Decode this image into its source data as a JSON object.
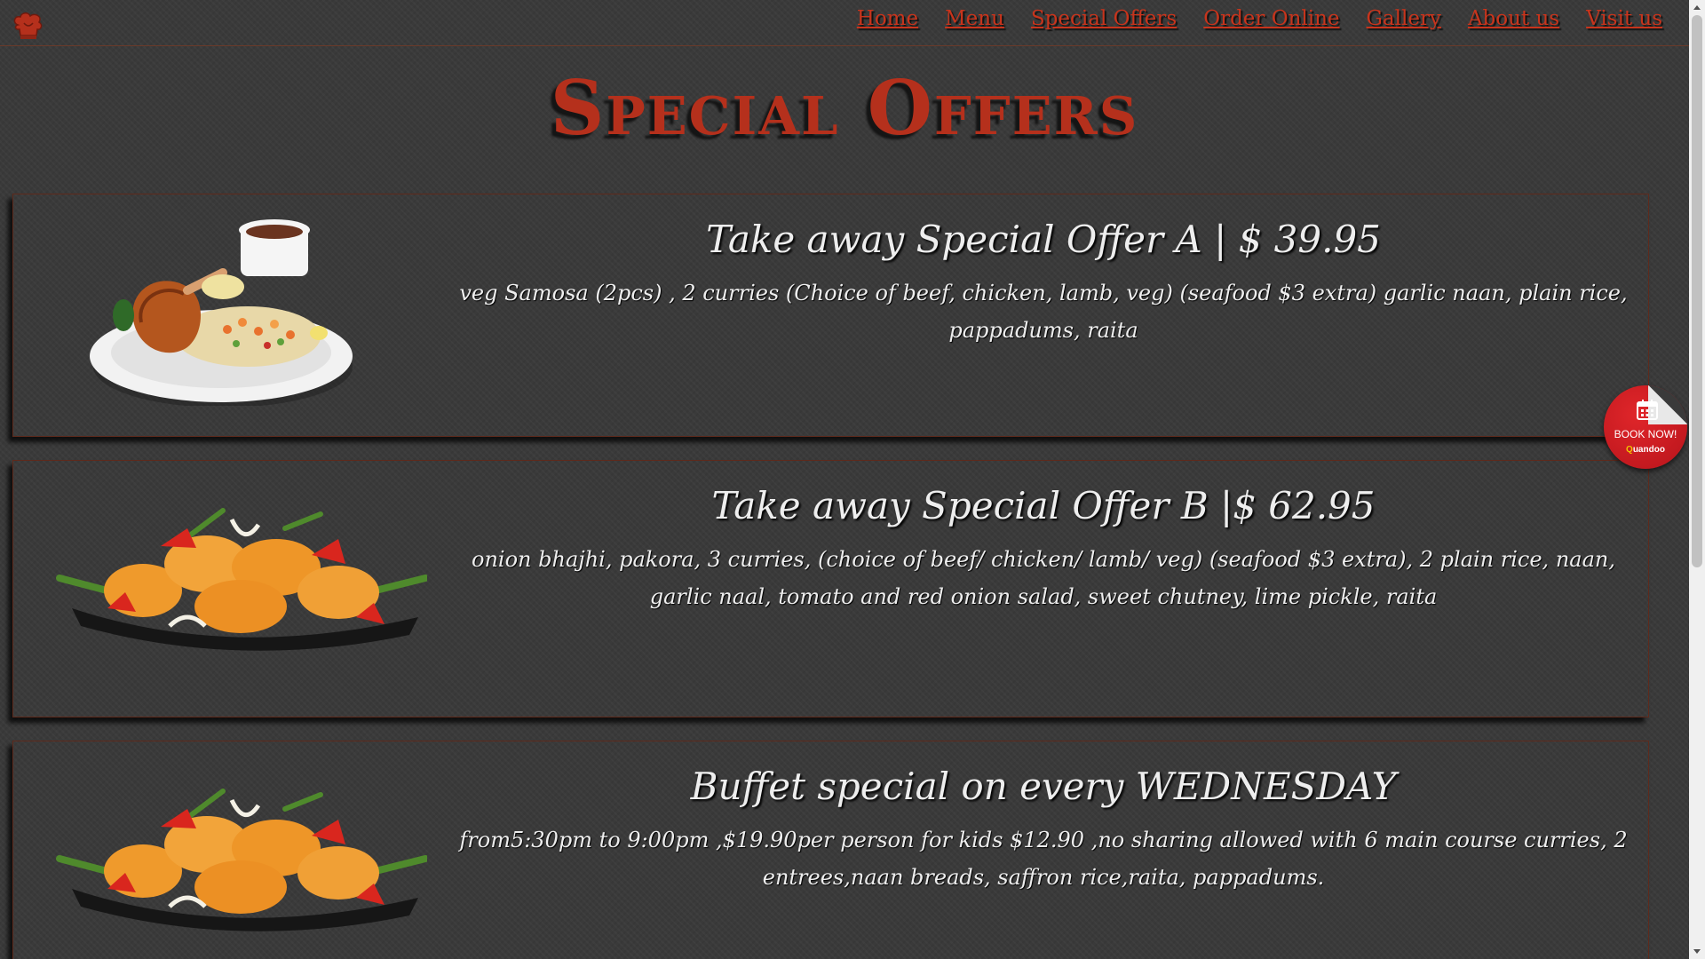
{
  "header": {
    "logo_icon": "chef-hat-icon",
    "nav": [
      "Home",
      "Menu",
      "Special Offers",
      "Order Online",
      "Gallery",
      "About us",
      "Visit us"
    ]
  },
  "page_title": "Special Offers",
  "offers": [
    {
      "title": "Take away Special Offer A | $ 39.95",
      "description": "veg Samosa (2pcs) , 2 curries (Choice of beef, chicken, lamb, veg) (seafood $3 extra) garlic naan, plain rice, pappadums, raita",
      "image": "chicken-rice-plate-image"
    },
    {
      "title": "Take away Special Offer B |$ 62.95",
      "description": "onion bhajhi, pakora, 3 curries, (choice of beef/ chicken/ lamb/ veg) (seafood $3 extra), 2 plain rice, naan, garlic naal, tomato and red onion salad, sweet chutney, lime pickle, raita",
      "image": "shrimp-dish-image"
    },
    {
      "title": "Buffet special on every WEDNESDAY",
      "description": "from5:30pm to 9:00pm ,$19.90per person for kids $12.90 ,no sharing allowed with 6 main course curries, 2 entrees,naan breads, saffron rice,raita, pappadums.",
      "image": "shrimp-dish-image"
    }
  ],
  "book_now": {
    "label": "BOOK NOW!",
    "brand_first": "Q",
    "brand_rest": "uandoo",
    "icon": "calendar-icon"
  },
  "colors": {
    "accent": "#b5301c",
    "background": "#3a3a3a",
    "book_now_red": "#d21f24"
  }
}
